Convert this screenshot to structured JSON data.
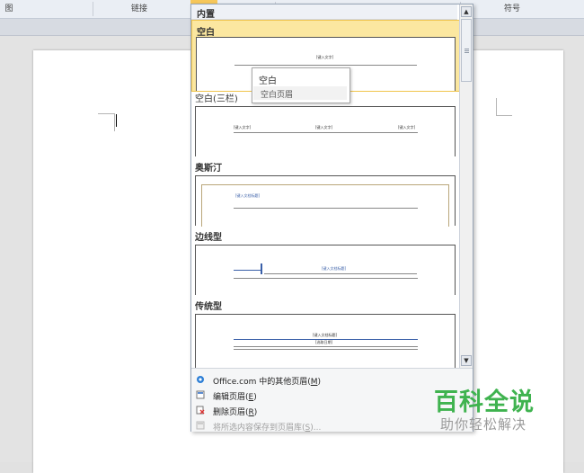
{
  "ribbon": {
    "groups": [
      "图",
      "链接",
      "符号"
    ]
  },
  "gallery": {
    "categories": {
      "builtin": "内置"
    },
    "items": [
      {
        "title": "空白",
        "texts": [
          "[键入文字]"
        ]
      },
      {
        "title": "空白(三栏)",
        "texts": [
          "[键入文字]",
          "[键入文字]",
          "[键入文字]"
        ]
      },
      {
        "title": "奥斯汀",
        "texts": [
          "[键入文档标题]"
        ]
      },
      {
        "title": "边线型",
        "texts": [
          "[键入文档标题]"
        ]
      },
      {
        "title": "传统型",
        "texts": [
          "[键入文档标题]",
          "[选取日期]"
        ]
      }
    ],
    "tooltip": {
      "title": "空白",
      "description": "空白页眉"
    },
    "scroll": {
      "up": "▲",
      "down": "▼"
    }
  },
  "menu": {
    "items": [
      {
        "label": "Office.com 中的其他页眉(",
        "key": "M",
        "suffix": ")",
        "icon": "office-icon"
      },
      {
        "label": "编辑页眉(",
        "key": "E",
        "suffix": ")",
        "icon": "edit-header-icon"
      },
      {
        "label": "删除页眉(",
        "key": "R",
        "suffix": ")",
        "icon": "delete-header-icon"
      },
      {
        "label": "将所选内容保存到页眉库(",
        "key": "S",
        "suffix": ")...",
        "icon": "save-selection-icon",
        "disabled": true
      }
    ]
  },
  "watermark": {
    "title": "百科全说",
    "subtitle": "助你轻松解决"
  },
  "colors": {
    "selected_bg": "#fbe7a0",
    "selected_border": "#f0c44a",
    "watermark_green": "#3fb34f"
  }
}
